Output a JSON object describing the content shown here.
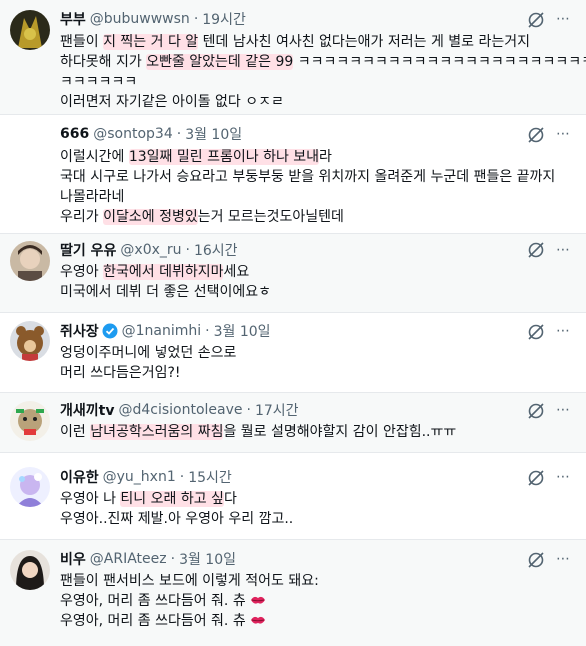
{
  "tweets": [
    {
      "name": "부부",
      "handle": "@bubuwwwsn",
      "time": "19시간",
      "lines": [
        [
          {
            "t": "팬들이 "
          },
          {
            "t": "지 찍는 거 다 알",
            "h": true
          },
          {
            "t": " 텐데 남사친 여사친 없다는애가 저러는 게 별로 라는거지"
          }
        ],
        [
          {
            "t": "하다못해 지가 "
          },
          {
            "t": "오빤줄 알았는데 같은 99",
            "h": true
          },
          {
            "t": " ㅋㅋㅋㅋㅋㅋㅋㅋㅋㅋㅋㅋㅋㅋㅋㅋㅋㅋㅋㅋㅋㅋㅋ"
          }
        ],
        [
          {
            "t": "ㅋㅋㅋㅋㅋㅋ"
          }
        ],
        [
          {
            "t": "이러면저 자기같은 아이돌 없다 ㅇㅈㄹ"
          }
        ]
      ]
    },
    {
      "name": "666",
      "handle": "@sontop34",
      "time": "3월 10일",
      "lines": [
        [
          {
            "t": "이럴시간에 "
          },
          {
            "t": "13일째 밀린 프롬이나 하나 보내",
            "h": true
          },
          {
            "t": "라"
          }
        ],
        [
          {
            "t": "국대 시구로 나가서 승요라고 부둥부둥 받을 위치까지 올려준게 누군데 팬들은 끝까지"
          }
        ],
        [
          {
            "t": "나몰라라네"
          }
        ],
        [
          {
            "t": "우리가 "
          },
          {
            "t": "이달소에 정병있",
            "h": true
          },
          {
            "t": "는거 모르는것도아닐텐데"
          }
        ]
      ]
    },
    {
      "name": "딸기 우유",
      "handle": "@x0x_ru",
      "time": "16시간",
      "lines": [
        [
          {
            "t": "우영아 "
          },
          {
            "t": "한국에서 데뷔하지마",
            "h": true
          },
          {
            "t": "세요"
          }
        ],
        [
          {
            "t": "미국에서 데뷔 더 좋은 선택이에요ㅎ"
          }
        ]
      ]
    },
    {
      "name": "쥐사장",
      "handle": "@1nanimhi",
      "time": "3월 10일",
      "lines": [
        [
          {
            "t": "엉덩이주머니에 넣었던 손으로"
          }
        ],
        [
          {
            "t": "머리 쓰다듬은거임?!"
          }
        ]
      ]
    },
    {
      "name": "개새끼tv",
      "handle": "@d4cisiontoleave",
      "time": "17시간",
      "lines": [
        [
          {
            "t": "이런 "
          },
          {
            "t": "남녀공학스러움의 짜침",
            "h": true
          },
          {
            "t": "을 뭘로 설명해야할지 감이 안잡힘..ㅠㅠ"
          }
        ]
      ]
    },
    {
      "name": "이유한",
      "handle": "@yu_hxn1",
      "time": "15시간",
      "lines": [
        [
          {
            "t": "우영아 나 "
          },
          {
            "t": "티니 오래 하고 싶",
            "h": true
          },
          {
            "t": "다"
          }
        ],
        [
          {
            "t": "우영아..진짜 제발.아 우영아 우리 깜고.."
          }
        ]
      ]
    },
    {
      "name": "비우",
      "handle": "@ARIAteez",
      "time": "3월 10일",
      "lines": [
        [
          {
            "t": "팬들이 팬서비스 보드에 이렇게 적어도 돼요:"
          }
        ],
        [
          {
            "t": "우영아, 머리 좀 쓰다듬어 줘. 츄 "
          },
          {
            "t": "kiss-lips-icon",
            "e": true
          }
        ],
        [
          {
            "t": "우영아, 머리 좀 쓰다듬어 줘. 츄 "
          },
          {
            "t": "kiss-lips-icon",
            "e": true
          }
        ]
      ]
    }
  ],
  "more_icon": "⋯"
}
